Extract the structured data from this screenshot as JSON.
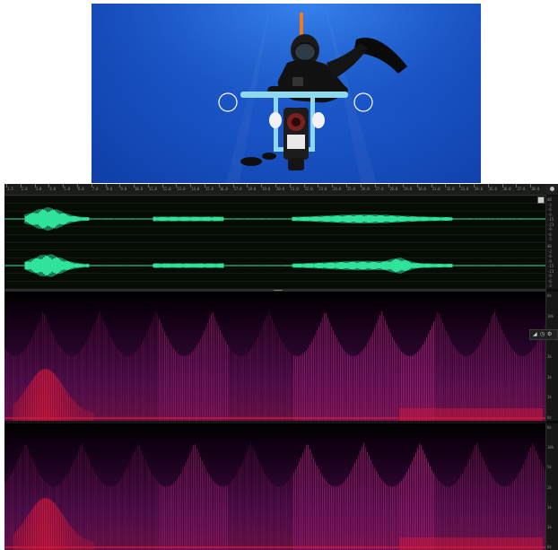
{
  "photo": {
    "subject": "freediver-holding-camera-rig-icon",
    "water_color": "#1a56c9"
  },
  "editor": {
    "timeline_labels": [
      "1.5",
      "2.8",
      "3.0",
      "4.0",
      "5.0",
      "6.0",
      "7.0",
      "8.0",
      "9.0",
      "10.0",
      "11.0",
      "12.0",
      "13.0",
      "14.0",
      "15.0",
      "16.0",
      "17.0",
      "18.0",
      "19.0",
      "20.0",
      "21.0",
      "22.0",
      "23.0",
      "24.0",
      "25.0",
      "26.0",
      "27.0",
      "28.0",
      "29.0",
      "30.0",
      "31.0",
      "32.0",
      "33.0",
      "34.0",
      "35.0",
      "36.0",
      "37.0",
      "38.0"
    ],
    "wave_scale_top": [
      "dB",
      "-3",
      "-6",
      "-9",
      "-15",
      "-21",
      "-9",
      "-6",
      "-3"
    ],
    "wave_scale_bottom": [
      "dB",
      "-3",
      "-6",
      "-9",
      "-15",
      "-21",
      "-9",
      "-6",
      "-3"
    ],
    "spec_scale_top": [
      "Hz",
      "10k",
      "5k",
      "2k",
      "1k",
      "1k",
      "Hz"
    ],
    "spec_scale_bottom": [
      "Hz",
      "10k",
      "5k",
      "2k",
      "1k",
      "1k",
      "Hz"
    ],
    "waveform_color": "#2fe39a",
    "spectral_color": "#d4183c"
  }
}
